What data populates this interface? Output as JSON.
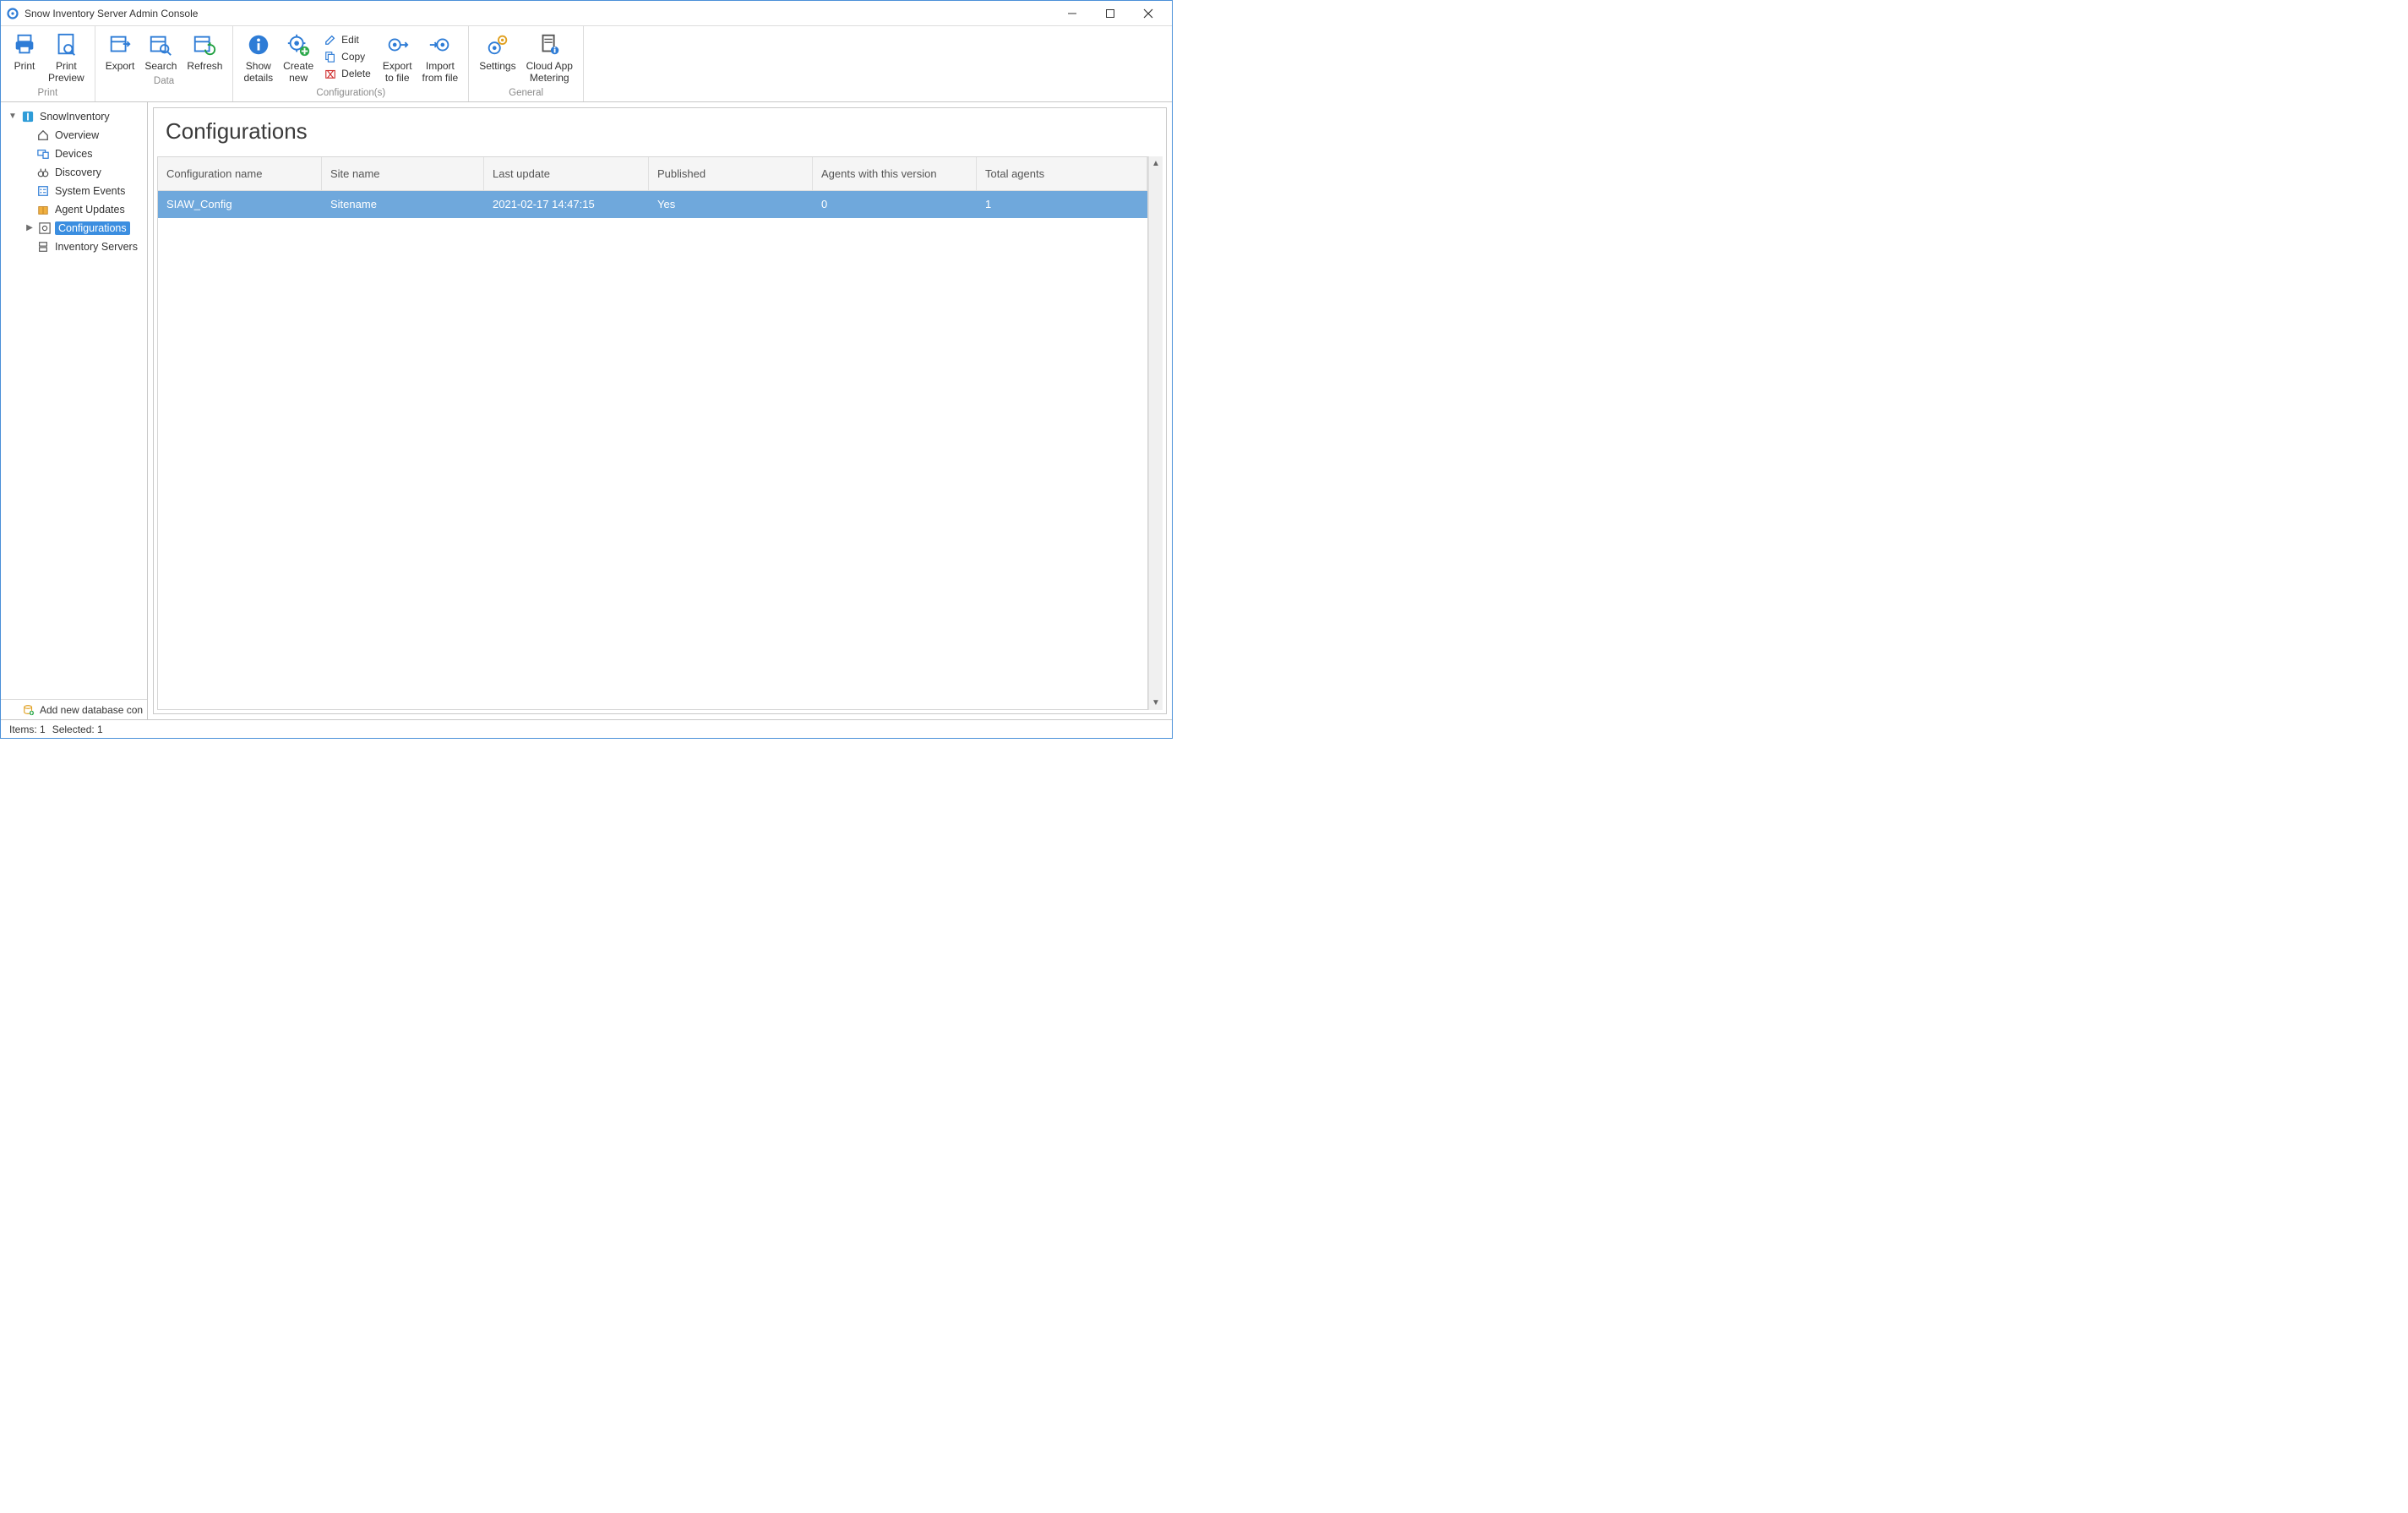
{
  "window": {
    "title": "Snow Inventory Server Admin Console"
  },
  "ribbon": {
    "groups": {
      "print": {
        "label": "Print",
        "print": "Print",
        "preview": "Print\nPreview"
      },
      "data": {
        "label": "Data",
        "export": "Export",
        "search": "Search",
        "refresh": "Refresh"
      },
      "config": {
        "label": "Configuration(s)",
        "show_details": "Show\ndetails",
        "create_new": "Create\nnew",
        "edit": "Edit",
        "copy": "Copy",
        "delete": "Delete",
        "export_file": "Export\nto file",
        "import_file": "Import\nfrom file"
      },
      "general": {
        "label": "General",
        "settings": "Settings",
        "cloud": "Cloud App\nMetering"
      }
    }
  },
  "tree": {
    "root": "SnowInventory",
    "items": {
      "overview": "Overview",
      "devices": "Devices",
      "discovery": "Discovery",
      "system_events": "System Events",
      "agent_updates": "Agent Updates",
      "configurations": "Configurations",
      "inventory_servers": "Inventory Servers"
    },
    "footer": "Add new database con"
  },
  "page": {
    "title": "Configurations"
  },
  "grid": {
    "columns": {
      "c0": "Configuration name",
      "c1": "Site name",
      "c2": "Last update",
      "c3": "Published",
      "c4": "Agents with this version",
      "c5": "Total agents"
    },
    "rows": [
      {
        "c0": "SIAW_Config",
        "c1": "Sitename",
        "c2": "2021-02-17 14:47:15",
        "c3": "Yes",
        "c4": "0",
        "c5": "1"
      }
    ]
  },
  "status": {
    "items": "Items: 1",
    "selected": "Selected: 1"
  }
}
